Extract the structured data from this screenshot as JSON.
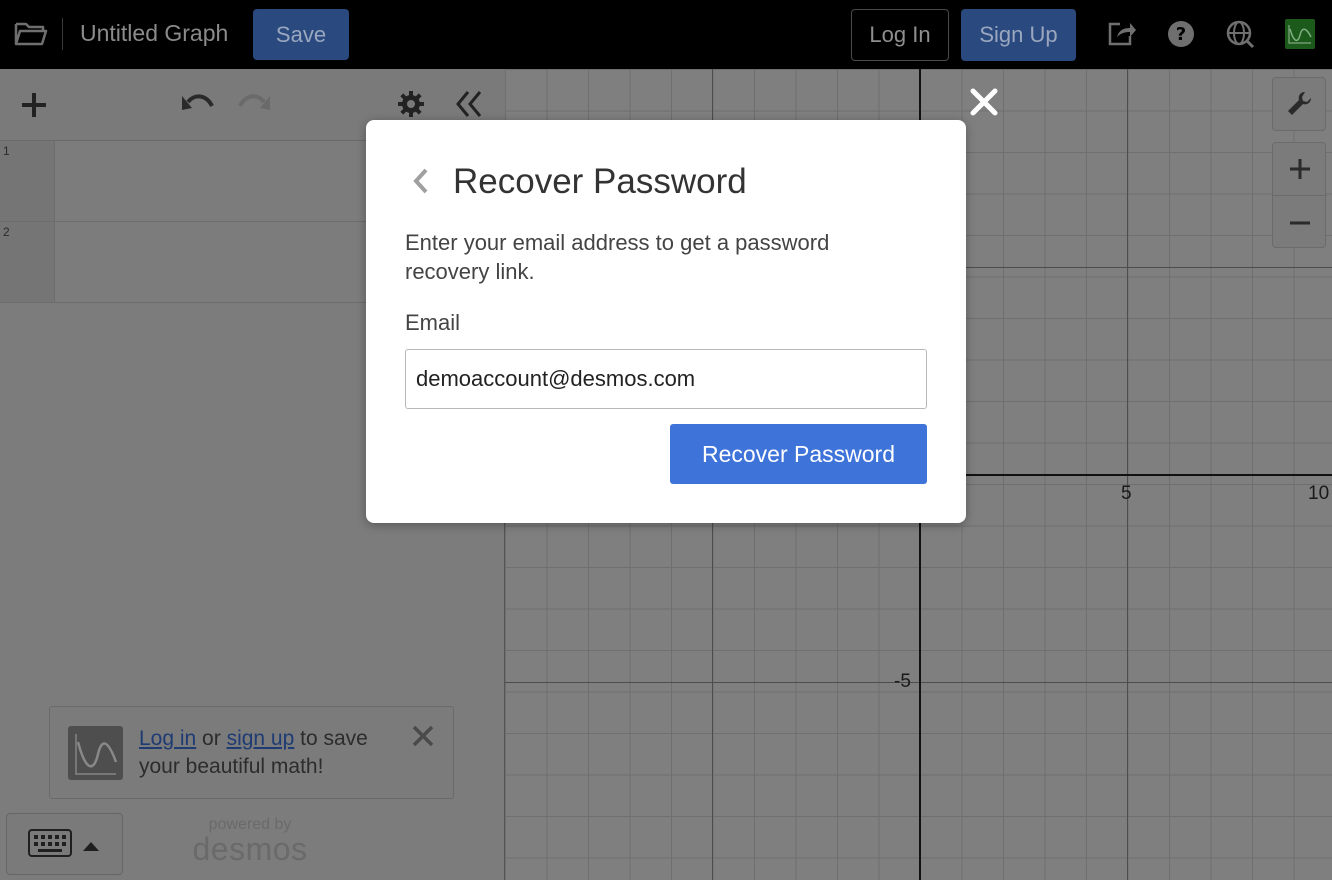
{
  "topbar": {
    "graph_title": "Untitled Graph",
    "save_label": "Save",
    "login_label": "Log In",
    "signup_label": "Sign Up",
    "icons": [
      "folder-icon",
      "share-icon",
      "help-icon",
      "globe-icon",
      "desmos-logo-icon"
    ]
  },
  "expressions": {
    "toolbar_icons": [
      "add-icon",
      "undo-icon",
      "redo-icon",
      "gear-icon",
      "collapse-icon"
    ],
    "rows": [
      {
        "index": "1"
      },
      {
        "index": "2"
      }
    ]
  },
  "promo": {
    "login_link": "Log in",
    "or_text": " or ",
    "signup_link": "sign up",
    "rest_text": " to save your beautiful math!"
  },
  "footer": {
    "powered_by": "powered by",
    "brand": "desmos"
  },
  "graph": {
    "tick_labels": [
      "5",
      "10",
      "-5"
    ]
  },
  "modal": {
    "title": "Recover Password",
    "description": "Enter your email address to get a password recovery link.",
    "email_label": "Email",
    "email_value": "demoaccount@desmos.com",
    "submit_label": "Recover Password"
  },
  "colors": {
    "accent": "#3e73d9",
    "topbar_bg": "#000000",
    "overlay_gray": "#7c7c7c"
  }
}
